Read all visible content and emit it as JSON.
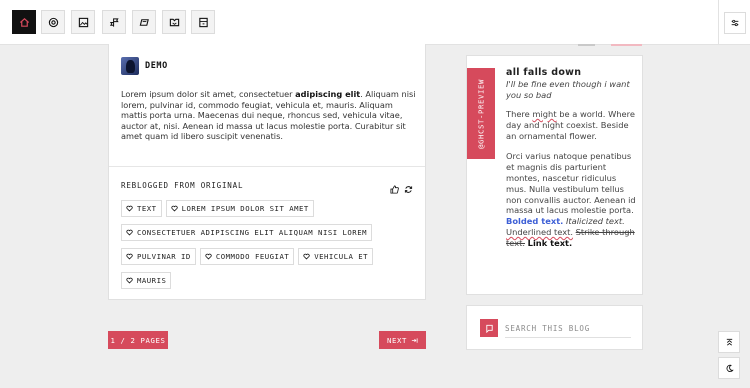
{
  "topbar": {
    "buttons": [
      {
        "icon": "home-icon",
        "active": true
      },
      {
        "icon": "at-icon"
      },
      {
        "icon": "image-icon"
      },
      {
        "icon": "quote-icon"
      },
      {
        "icon": "link-icon"
      },
      {
        "icon": "chat-icon"
      },
      {
        "icon": "audio-icon"
      }
    ],
    "right_icon": "settings-sliders-icon"
  },
  "post": {
    "author": "DEMO",
    "body_pre": "Lorem ipsum dolor sit amet, consectetuer ",
    "body_bold": "adipiscing elit",
    "body_post": ". Aliquam nisi lorem, pulvinar id, commodo feugiat, vehicula et, mauris. Aliquam mattis porta urna. Maecenas dui neque, rhoncus sed, vehicula vitae, auctor at, nisi. Aenean id massa ut lacus molestie porta. Curabitur sit amet quam id libero suscipit venenatis.",
    "reblogged_label": "REBLOGGED FROM ORIGINAL",
    "tags": [
      "TEXT",
      "LOREM IPSUM DOLOR SIT AMET",
      "CONSECTETUER ADIPISCING ELIT ALIQUAM NISI LOREM",
      "PULVINAR ID",
      "COMMODO FEUGIAT",
      "VEHICULA ET",
      "MAURIS"
    ]
  },
  "pagination": {
    "page_label": "1 / 2 PAGES",
    "next_label": "NEXT"
  },
  "sidebar": {
    "ribbon_text": "@GHCST-PREVIEW",
    "title": "all falls down",
    "subtitle": "I'll be fine even though i want you so bad",
    "desc1_a": "There ",
    "desc1_squiggle": "might",
    "desc1_b": " be a world. Where day and night coexist. Beside an ornamental flower.",
    "desc2_a": "Orci varius natoque penatibus et magnis dis parturient montes, nascetur ridiculus mus. Nulla vestibulum tellus non convallis auctor. Aenean id massa ut lacus molestie porta. ",
    "desc2_bold": "Bolded text.",
    "desc2_italic": "Italicized text.",
    "desc2_underlined": "Underlined text.",
    "desc2_strike": "Strike through text.",
    "desc2_link": "Link text."
  },
  "search": {
    "placeholder": "SEARCH THIS BLOG"
  },
  "colors": {
    "accent": "#d64a5c",
    "link_blue": "#3d5fd6"
  }
}
